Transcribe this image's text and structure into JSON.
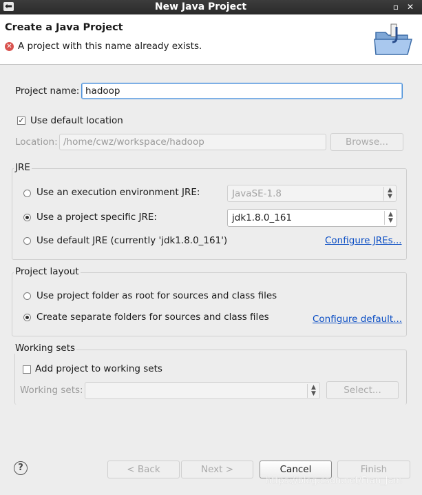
{
  "window": {
    "title": "New Java Project"
  },
  "header": {
    "title": "Create a Java Project",
    "error": "A project with this name already exists."
  },
  "form": {
    "project_name_label": "Project name:",
    "project_name_value": "hadoop",
    "use_default_location_label": "Use default location",
    "use_default_location_checked": true,
    "location_label": "Location:",
    "location_value": "/home/cwz/workspace/hadoop",
    "browse_label": "Browse..."
  },
  "jre": {
    "group_label": "JRE",
    "option_env": "Use an execution environment JRE:",
    "env_value": "JavaSE-1.8",
    "option_specific": "Use a project specific JRE:",
    "specific_value": "jdk1.8.0_161",
    "option_default": "Use default JRE (currently 'jdk1.8.0_161')",
    "configure_link": "Configure JREs...",
    "selected": "specific"
  },
  "layout": {
    "group_label": "Project layout",
    "option_root": "Use project folder as root for sources and class files",
    "option_separate": "Create separate folders for sources and class files",
    "configure_link": "Configure default...",
    "selected": "separate"
  },
  "working_sets": {
    "group_label": "Working sets",
    "add_label": "Add project to working sets",
    "add_checked": false,
    "sets_label": "Working sets:",
    "sets_value": "",
    "select_label": "Select..."
  },
  "buttons": {
    "back": "< Back",
    "next": "Next >",
    "cancel": "Cancel",
    "finish": "Finish"
  },
  "watermark": "https://blog.csdn.net/Fran_Jam",
  "icons": [
    "back-arrow-icon",
    "minimize-icon",
    "close-icon",
    "error-icon",
    "java-project-folder-icon",
    "help-icon"
  ]
}
